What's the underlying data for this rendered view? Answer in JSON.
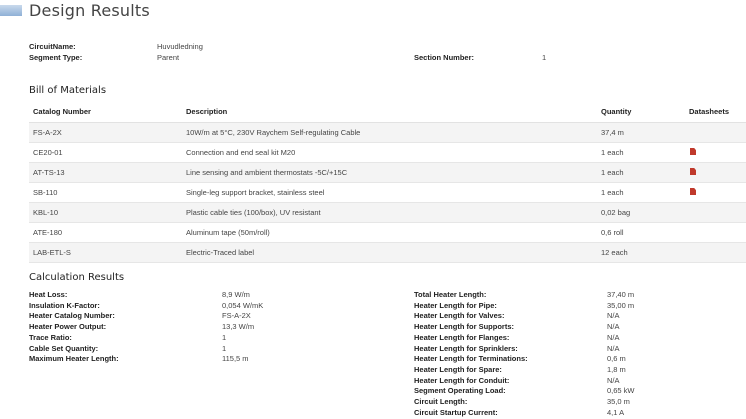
{
  "header": {
    "title": "Design Results"
  },
  "info": {
    "circuit_name_label": "CircuitName:",
    "circuit_name_value": "Huvudledning",
    "segment_type_label": "Segment Type:",
    "segment_type_value": "Parent",
    "section_number_label": "Section Number:",
    "section_number_value": "1"
  },
  "bom": {
    "title": "Bill of Materials",
    "columns": [
      "Catalog Number",
      "Description",
      "Quantity",
      "Datasheets"
    ],
    "rows": [
      {
        "catalog": "FS-A-2X",
        "description": "10W/m at 5°C, 230V Raychem Self-regulating Cable",
        "quantity": "37,4 m",
        "datasheet": false
      },
      {
        "catalog": "CE20-01",
        "description": "Connection and end seal kit M20",
        "quantity": "1 each",
        "datasheet": true
      },
      {
        "catalog": "AT-TS-13",
        "description": "Line sensing and ambient thermostats -5C/+15C",
        "quantity": "1 each",
        "datasheet": true
      },
      {
        "catalog": "SB-110",
        "description": "Single-leg support bracket, stainless steel",
        "quantity": "1 each",
        "datasheet": true
      },
      {
        "catalog": "KBL-10",
        "description": "Plastic cable ties (100/box), UV resistant",
        "quantity": "0,02 bag",
        "datasheet": false
      },
      {
        "catalog": "ATE-180",
        "description": "Aluminum tape (50m/roll)",
        "quantity": "0,6 roll",
        "datasheet": false
      },
      {
        "catalog": "LAB-ETL-S",
        "description": "Electric-Traced label",
        "quantity": "12 each",
        "datasheet": false
      }
    ],
    "datasheet_icon": "pdf-icon",
    "icon_color": "#c0392b"
  },
  "calc": {
    "title": "Calculation Results",
    "left": [
      {
        "label": "Heat Loss:",
        "value": "8,9 W/m"
      },
      {
        "label": "Insulation K-Factor:",
        "value": "0,054 W/mK"
      },
      {
        "label": "Heater Catalog Number:",
        "value": "FS-A-2X"
      },
      {
        "label": "Heater Power Output:",
        "value": "13,3 W/m"
      },
      {
        "label": "Trace Ratio:",
        "value": "1"
      },
      {
        "label": "Cable Set Quantity:",
        "value": "1"
      },
      {
        "label": "Maximum Heater Length:",
        "value": "115,5 m"
      }
    ],
    "right": [
      {
        "label": "Total Heater Length:",
        "value": "37,40 m"
      },
      {
        "label": "Heater Length for Pipe:",
        "value": "35,00 m"
      },
      {
        "label": "Heater Length for Valves:",
        "value": "N/A"
      },
      {
        "label": "Heater Length for Supports:",
        "value": "N/A"
      },
      {
        "label": "Heater Length for Flanges:",
        "value": "N/A"
      },
      {
        "label": "Heater Length for Sprinklers:",
        "value": "N/A"
      },
      {
        "label": "Heater Length for Terminations:",
        "value": "0,6 m"
      },
      {
        "label": "Heater Length for Spare:",
        "value": "1,8 m"
      },
      {
        "label": "Heater Length for Conduit:",
        "value": "N/A"
      },
      {
        "label": "Segment Operating Load:",
        "value": "0,65 kW"
      },
      {
        "label": "Circuit Length:",
        "value": "35,0 m"
      },
      {
        "label": "Circuit Startup Current:",
        "value": "4,1 A"
      }
    ]
  }
}
